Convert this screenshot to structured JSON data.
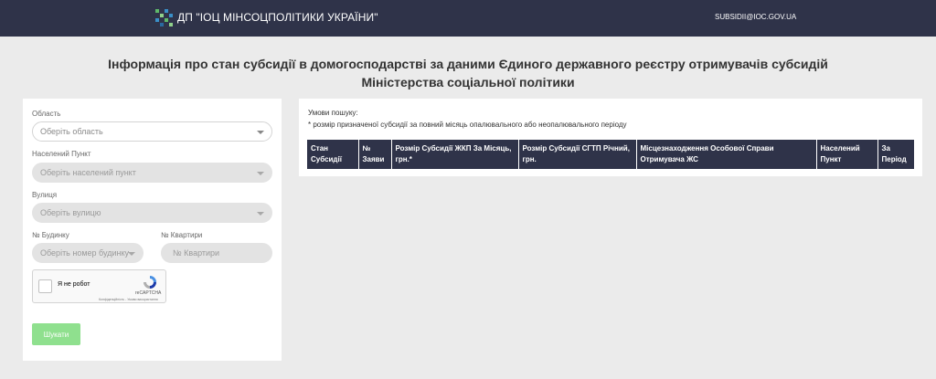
{
  "header": {
    "brand": "ДП \"ІОЦ МІНСОЦПОЛІТИКИ УКРАЇНИ\"",
    "email": "SUBSIDII@IOC.GOV.UA",
    "logo_colors": [
      "#5fb96a",
      "#3a8fc7",
      "#8fd08a",
      "#2a6aa0"
    ]
  },
  "page": {
    "title_line1": "Інформація про стан субсидії в домогосподарстві за даними Єдиного державного реєстру отримувачів субсидій",
    "title_line2": "Міністерства соціальної політики"
  },
  "form": {
    "region_label": "Область",
    "region_placeholder": "Оберіть область",
    "locality_label": "Населений Пункт",
    "locality_placeholder": "Оберіть населений пункт",
    "street_label": "Вулиця",
    "street_placeholder": "Оберіть вулицю",
    "house_label": "№ Будинку",
    "house_placeholder": "Оберіть номер будинку",
    "apartment_label": "№ Квартири",
    "apartment_placeholder": "№ Квартири",
    "captcha_label": "Я не робот",
    "captcha_brand": "reCAPTCHA",
    "captcha_links": "Конфіденційність - Умови використання",
    "search_button": "Шукати"
  },
  "results": {
    "conditions_title": "Умови пошуку:",
    "conditions_text": "* розмір призначеної субсидії за повний місяць опалювального або неопалювального періоду",
    "columns": [
      "Стан Субсидії",
      "№ Заяви",
      "Розмір Субсидії ЖКП За Місяць, грн.*",
      "Розмір Субсидії СГТП Річний, грн.",
      "Місцезнаходження Особової Справи Отримувача ЖС",
      "Населений Пункт",
      "За Період"
    ]
  }
}
